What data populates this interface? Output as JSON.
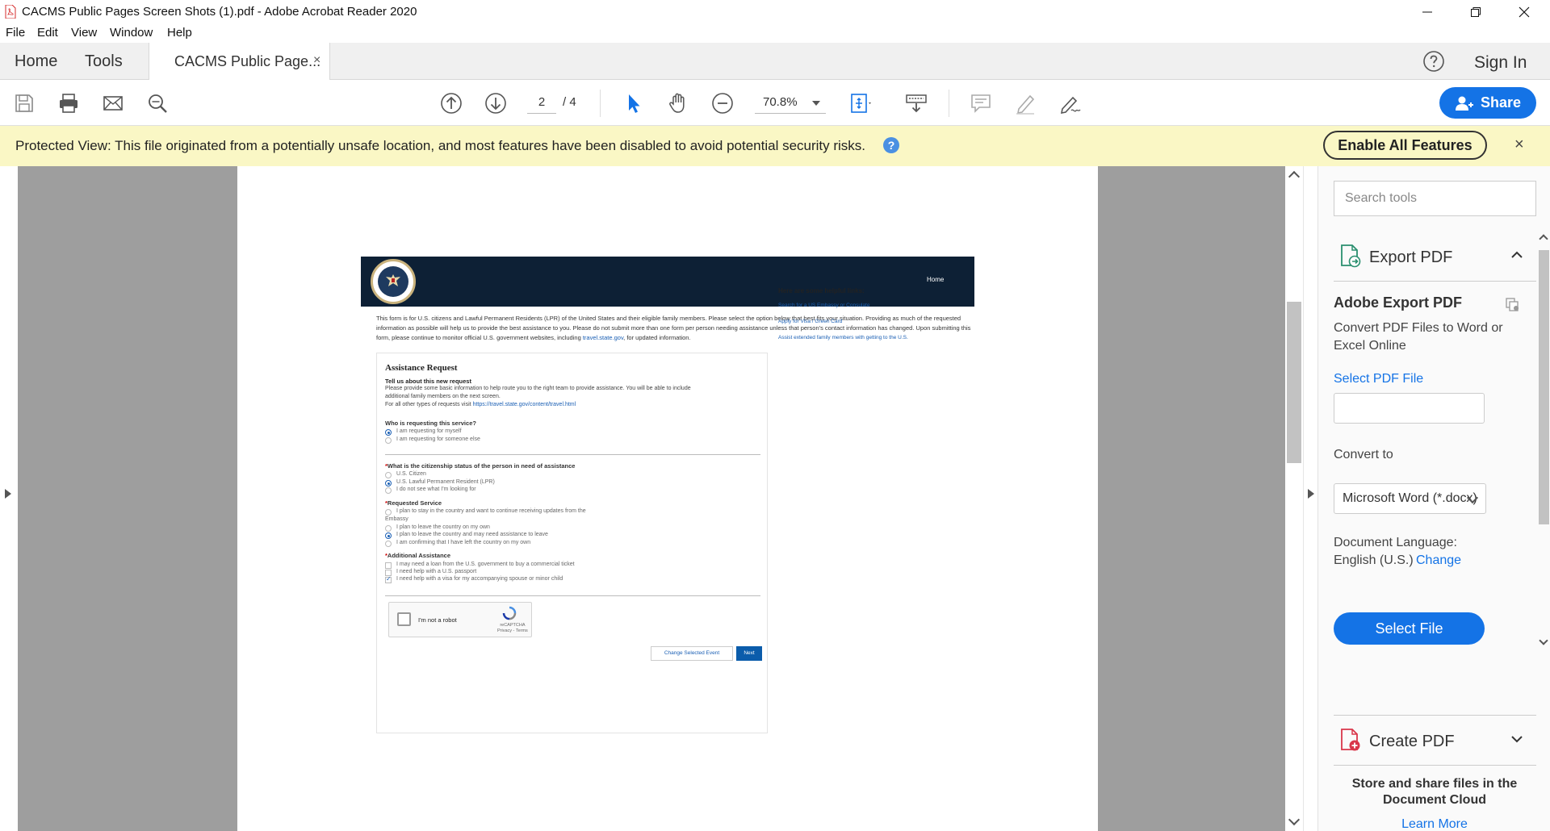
{
  "window": {
    "title": "CACMS Public Pages Screen Shots (1).pdf - Adobe Acrobat Reader 2020"
  },
  "menu": {
    "items": [
      "File",
      "Edit",
      "View",
      "Window",
      "Help"
    ]
  },
  "tabs": {
    "home": "Home",
    "tools": "Tools",
    "document": "CACMS Public Page...",
    "close": "×",
    "sign_in": "Sign In"
  },
  "toolbar": {
    "page_current": "2",
    "page_total": "/ 4",
    "zoom": "70.8%",
    "share": "Share"
  },
  "banner": {
    "message": "Protected View: This file originated from a potentially unsafe location, and most features have been disabled to avoid potential security risks.",
    "info": "?",
    "enable": "Enable All Features",
    "close": "×"
  },
  "pdf": {
    "site_nav_home": "Home",
    "intro_text": "This form is for U.S. citizens and Lawful Permanent Residents (LPR) of the United States and their eligible family members. Please select the option below that best fits your situation. Providing as much of the requested information as possible will help us to provide the best assistance to you. Please do not submit more than one form per person needing assistance unless that person's contact information has changed. Upon submitting this form, please continue to monitor official U.S. government websites, including",
    "intro_link": "travel.state.gov",
    "intro_tail": ", for updated information.",
    "form": {
      "title": "Assistance Request",
      "subtitle": "Tell us about this new request",
      "desc1": "Please provide some basic information to help route you to the right team to provide assistance. You will be able to include",
      "desc2": "additional family members on the next screen.",
      "desc3": "For all other types of requests visit",
      "desc3_link": "https://travel.state.gov/content/travel.html",
      "q1": "Who is requesting this service?",
      "q1_opt1": "I am requesting for myself",
      "q1_opt2": "I am requesting for someone else",
      "q2": "What is the citizenship status of the person in need of assistance",
      "q2_opt1": "U.S. Citizen",
      "q2_opt2": "U.S. Lawful Permanent Resident (LPR)",
      "q2_opt3": "I do not see what I'm looking for",
      "q3": "Requested Service",
      "q3_opt1": "I plan to stay in the country and want to continue receiving updates from the",
      "q3_opt1b": "Embassy",
      "q3_opt2": "I plan to leave the country on my own",
      "q3_opt3": "I plan to leave the country and may need assistance to leave",
      "q3_opt4": "I am confirming that I have left the country on my own",
      "q4": "Additional Assistance",
      "q4_opt1": "I may need a loan from the U.S. government to buy a commercial ticket",
      "q4_opt2": "I need help with a U.S. passport",
      "q4_opt3": "I need help with a visa for my accompanying spouse or minor child",
      "captcha_label": "I'm not a robot",
      "captcha_brand": "reCAPTCHA",
      "captcha_terms": "Privacy - Terms",
      "btn_change": "Change Selected Event",
      "btn_next": "Next"
    },
    "helpful": {
      "heading": "Here are some helpful links:",
      "links": [
        "Search for a US Embassy or Consulate",
        "Apply for Visa / Green Card",
        "Assist extended family members with getting to the U.S."
      ]
    }
  },
  "right_panel": {
    "search_placeholder": "Search tools",
    "export_pdf": "Export PDF",
    "adobe_export_title": "Adobe Export PDF",
    "adobe_export_desc": "Convert PDF Files to Word or Excel Online",
    "select_pdf_file": "Select PDF File",
    "convert_to": "Convert to",
    "convert_option": "Microsoft Word (*.docx)",
    "doc_language_label": "Document Language:",
    "doc_language_value": "English (U.S.)",
    "change": "Change",
    "select_file": "Select File",
    "create_pdf": "Create PDF",
    "cloud_text": "Store and share files in the Document Cloud",
    "learn_more": "Learn More"
  },
  "colors": {
    "accent": "#1473e6",
    "banner": "#faf7c5",
    "site_header": "#0d2035"
  }
}
